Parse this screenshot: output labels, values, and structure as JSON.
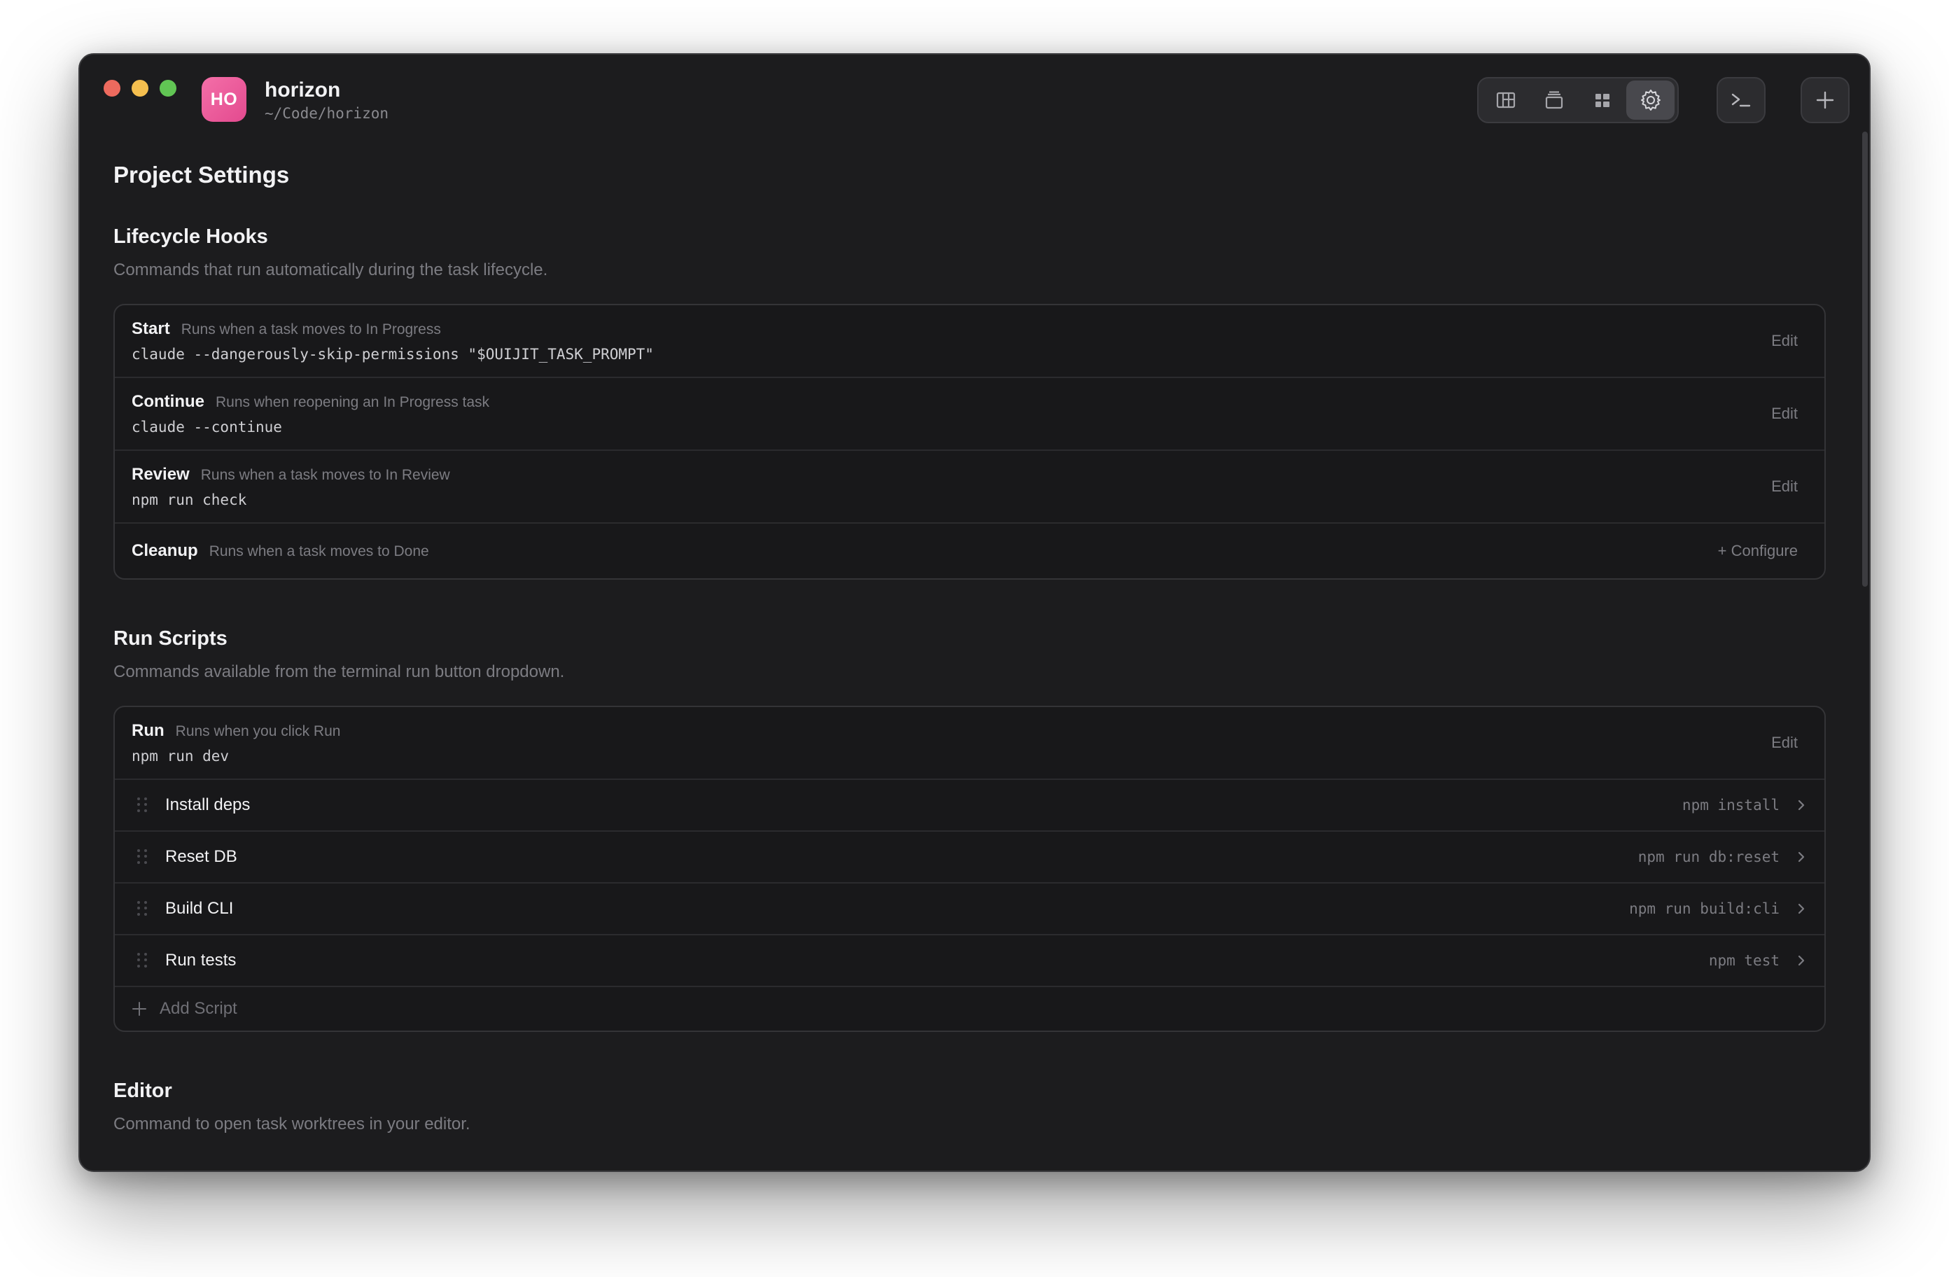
{
  "header": {
    "avatar_initials": "HO",
    "project_name": "horizon",
    "project_path": "~/Code/horizon",
    "icons": [
      "board-icon",
      "stack-icon",
      "grid-icon",
      "settings-icon",
      "terminal-icon",
      "plus-icon"
    ],
    "active_view": "settings"
  },
  "page": {
    "title": "Project Settings"
  },
  "lifecycle": {
    "title": "Lifecycle Hooks",
    "description": "Commands that run automatically during the task lifecycle.",
    "hooks": [
      {
        "name": "Start",
        "desc": "Runs when a task moves to In Progress",
        "cmd": "claude --dangerously-skip-permissions \"$OUIJIT_TASK_PROMPT\"",
        "action": "Edit"
      },
      {
        "name": "Continue",
        "desc": "Runs when reopening an In Progress task",
        "cmd": "claude --continue",
        "action": "Edit"
      },
      {
        "name": "Review",
        "desc": "Runs when a task moves to In Review",
        "cmd": "npm run check",
        "action": "Edit"
      },
      {
        "name": "Cleanup",
        "desc": "Runs when a task moves to Done",
        "action": "+ Configure"
      }
    ]
  },
  "run_scripts": {
    "title": "Run Scripts",
    "description": "Commands available from the terminal run button dropdown.",
    "run": {
      "name": "Run",
      "desc": "Runs when you click Run",
      "cmd": "npm run dev",
      "action": "Edit"
    },
    "scripts": [
      {
        "name": "Install deps",
        "cmd": "npm install"
      },
      {
        "name": "Reset DB",
        "cmd": "npm run db:reset"
      },
      {
        "name": "Build CLI",
        "cmd": "npm run build:cli"
      },
      {
        "name": "Run tests",
        "cmd": "npm test"
      }
    ],
    "add_label": "Add Script"
  },
  "editor": {
    "title": "Editor",
    "description": "Command to open task worktrees in your editor."
  },
  "colors": {
    "window_bg": "#1c1c1e",
    "card_bg": "#18181a",
    "avatar": "#e85a9b",
    "text_primary": "#f2f2f4",
    "text_muted": "#7c7c82"
  }
}
